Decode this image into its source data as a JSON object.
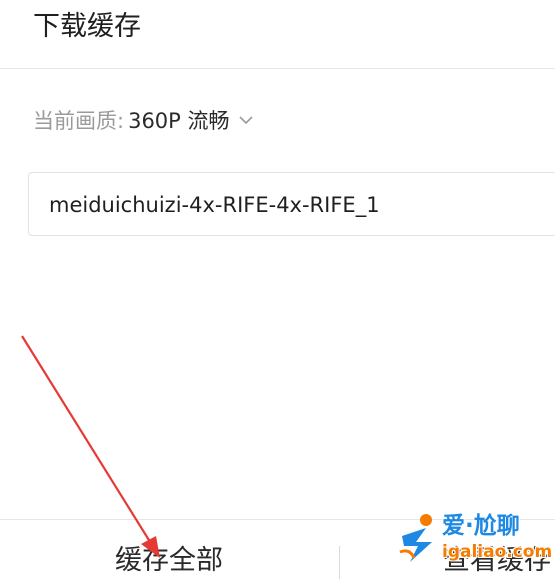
{
  "header": {
    "title": "下载缓存"
  },
  "quality": {
    "label": "当前画质:",
    "value": "360P 流畅",
    "icon": "chevron-down-icon"
  },
  "episodes": [
    {
      "label": "meiduichuizi-4x-RIFE-4x-RIFE_1"
    }
  ],
  "bottom_bar": {
    "cache_all_label": "缓存全部",
    "view_cache_label": "查看缓存"
  },
  "annotation": {
    "arrow_color": "#e53935"
  },
  "watermark": {
    "title": "爱·尬聊",
    "url": "igaliao.com",
    "colors": {
      "title": "#1e88e5",
      "url": "#f57c00"
    }
  }
}
